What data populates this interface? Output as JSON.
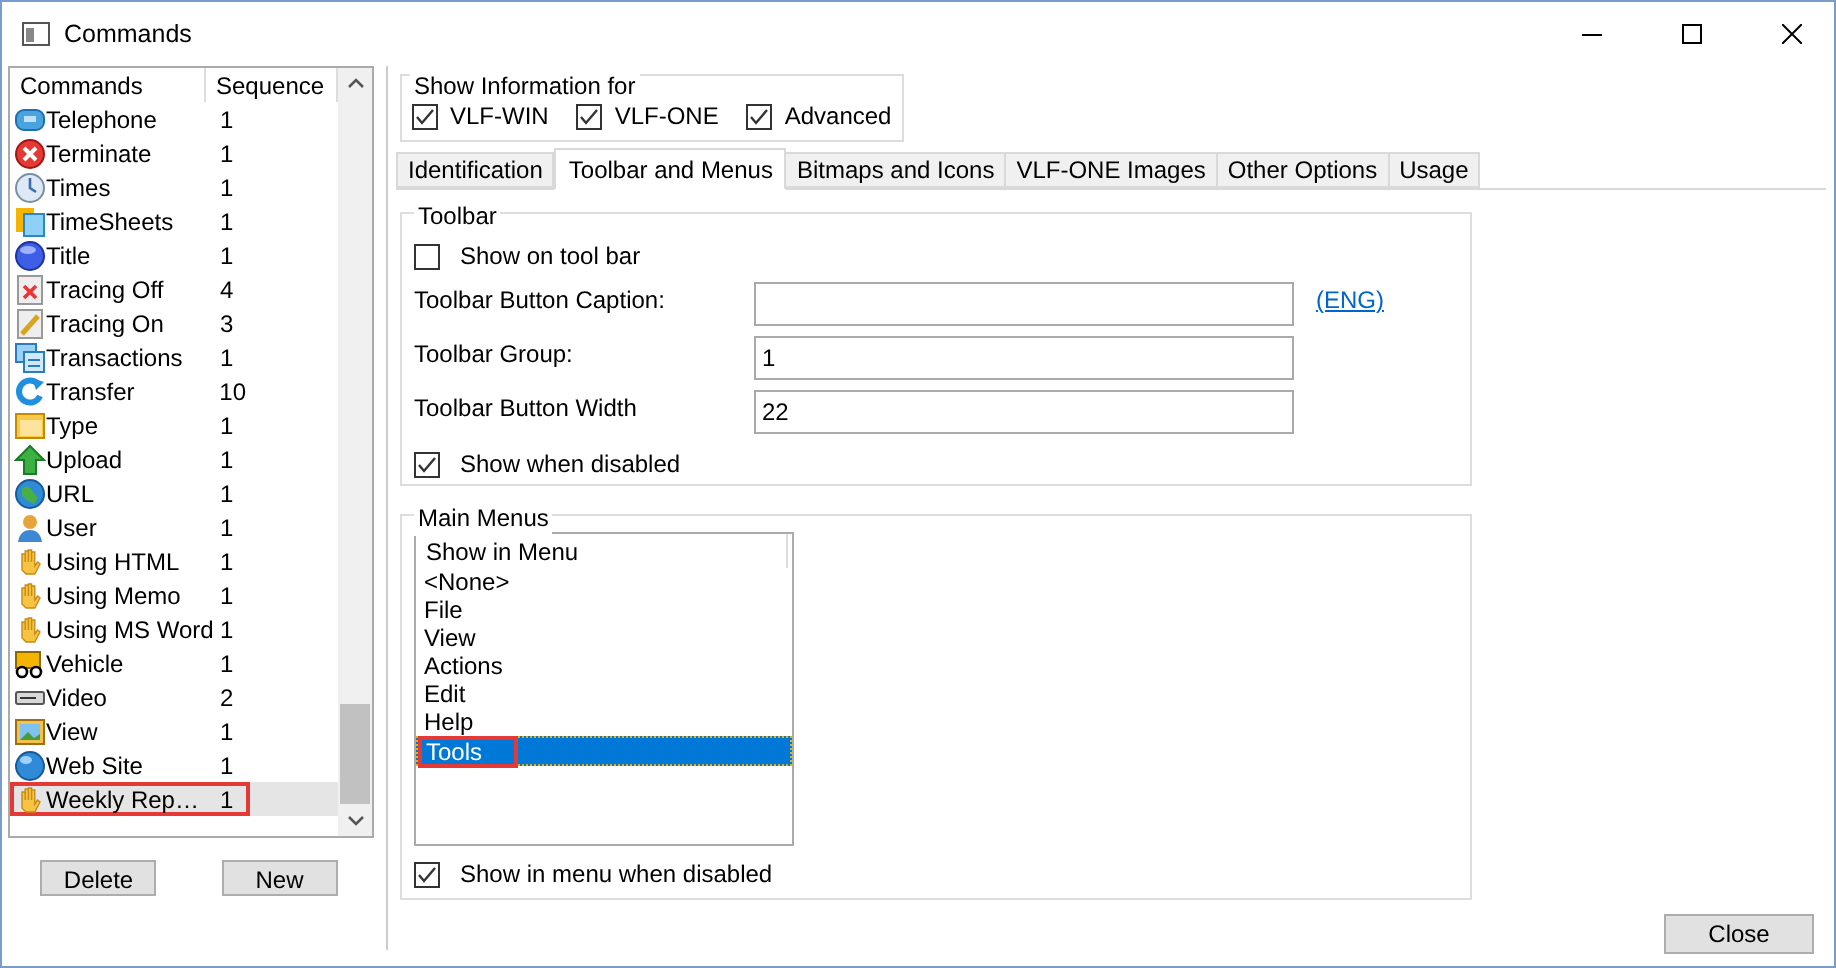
{
  "window": {
    "title": "Commands"
  },
  "commands": {
    "columns": [
      "Commands",
      "Sequence"
    ],
    "rows": [
      {
        "name": "Telephone",
        "sequence": "1",
        "selected": false
      },
      {
        "name": "Terminate",
        "sequence": "1",
        "selected": false
      },
      {
        "name": "Times",
        "sequence": "1",
        "selected": false
      },
      {
        "name": "TimeSheets",
        "sequence": "1",
        "selected": false
      },
      {
        "name": "Title",
        "sequence": "1",
        "selected": false
      },
      {
        "name": "Tracing Off",
        "sequence": "4",
        "selected": false
      },
      {
        "name": "Tracing On",
        "sequence": "3",
        "selected": false
      },
      {
        "name": "Transactions",
        "sequence": "1",
        "selected": false
      },
      {
        "name": "Transfer",
        "sequence": "10",
        "selected": false
      },
      {
        "name": "Type",
        "sequence": "1",
        "selected": false
      },
      {
        "name": "Upload",
        "sequence": "1",
        "selected": false
      },
      {
        "name": "URL",
        "sequence": "1",
        "selected": false
      },
      {
        "name": "User",
        "sequence": "1",
        "selected": false
      },
      {
        "name": "Using HTML",
        "sequence": "1",
        "selected": false
      },
      {
        "name": "Using Memo",
        "sequence": "1",
        "selected": false
      },
      {
        "name": "Using MS Word",
        "sequence": "1",
        "selected": false
      },
      {
        "name": "Vehicle",
        "sequence": "1",
        "selected": false
      },
      {
        "name": "Video",
        "sequence": "2",
        "selected": false
      },
      {
        "name": "View",
        "sequence": "1",
        "selected": false
      },
      {
        "name": "Web Site",
        "sequence": "1",
        "selected": false
      },
      {
        "name": "Weekly Rep…",
        "sequence": "1",
        "selected": true,
        "annotated": true
      }
    ],
    "buttons": [
      "Delete",
      "New"
    ]
  },
  "show_information_for": {
    "title": "Show Information for",
    "options": [
      {
        "label": "VLF-WIN",
        "checked": true
      },
      {
        "label": "VLF-ONE",
        "checked": true
      },
      {
        "label": "Advanced",
        "checked": true
      }
    ]
  },
  "tabs": [
    {
      "label": "Identification",
      "selected": false
    },
    {
      "label": "Toolbar and Menus",
      "selected": true
    },
    {
      "label": "Bitmaps and Icons",
      "selected": false
    },
    {
      "label": "VLF-ONE Images",
      "selected": false
    },
    {
      "label": "Other Options",
      "selected": false
    },
    {
      "label": "Usage",
      "selected": false
    }
  ],
  "toolbar": {
    "title": "Toolbar",
    "show_on_tool_bar": {
      "label": "Show on tool bar",
      "checked": false
    },
    "fields": [
      {
        "label": "Toolbar Button Caption:",
        "link": "(ENG)"
      },
      {
        "label": "Toolbar Group:",
        "value": "1"
      },
      {
        "label": "Toolbar Button Width",
        "value": "22"
      }
    ],
    "show_when_disabled": {
      "label": "Show when disabled",
      "checked": true
    }
  },
  "main_menus": {
    "title": "Main Menus",
    "list_header": "Show in Menu",
    "items": [
      {
        "label": "<None>",
        "selected": false
      },
      {
        "label": "File",
        "selected": false
      },
      {
        "label": "View",
        "selected": false
      },
      {
        "label": "Actions",
        "selected": false
      },
      {
        "label": "Edit",
        "selected": false
      },
      {
        "label": "Help",
        "selected": false
      },
      {
        "label": "Tools",
        "selected": true,
        "annotated": true
      }
    ],
    "show_in_menu_when_disabled": {
      "label": "Show in menu when disabled",
      "checked": true
    }
  },
  "buttons": [
    "Close"
  ]
}
